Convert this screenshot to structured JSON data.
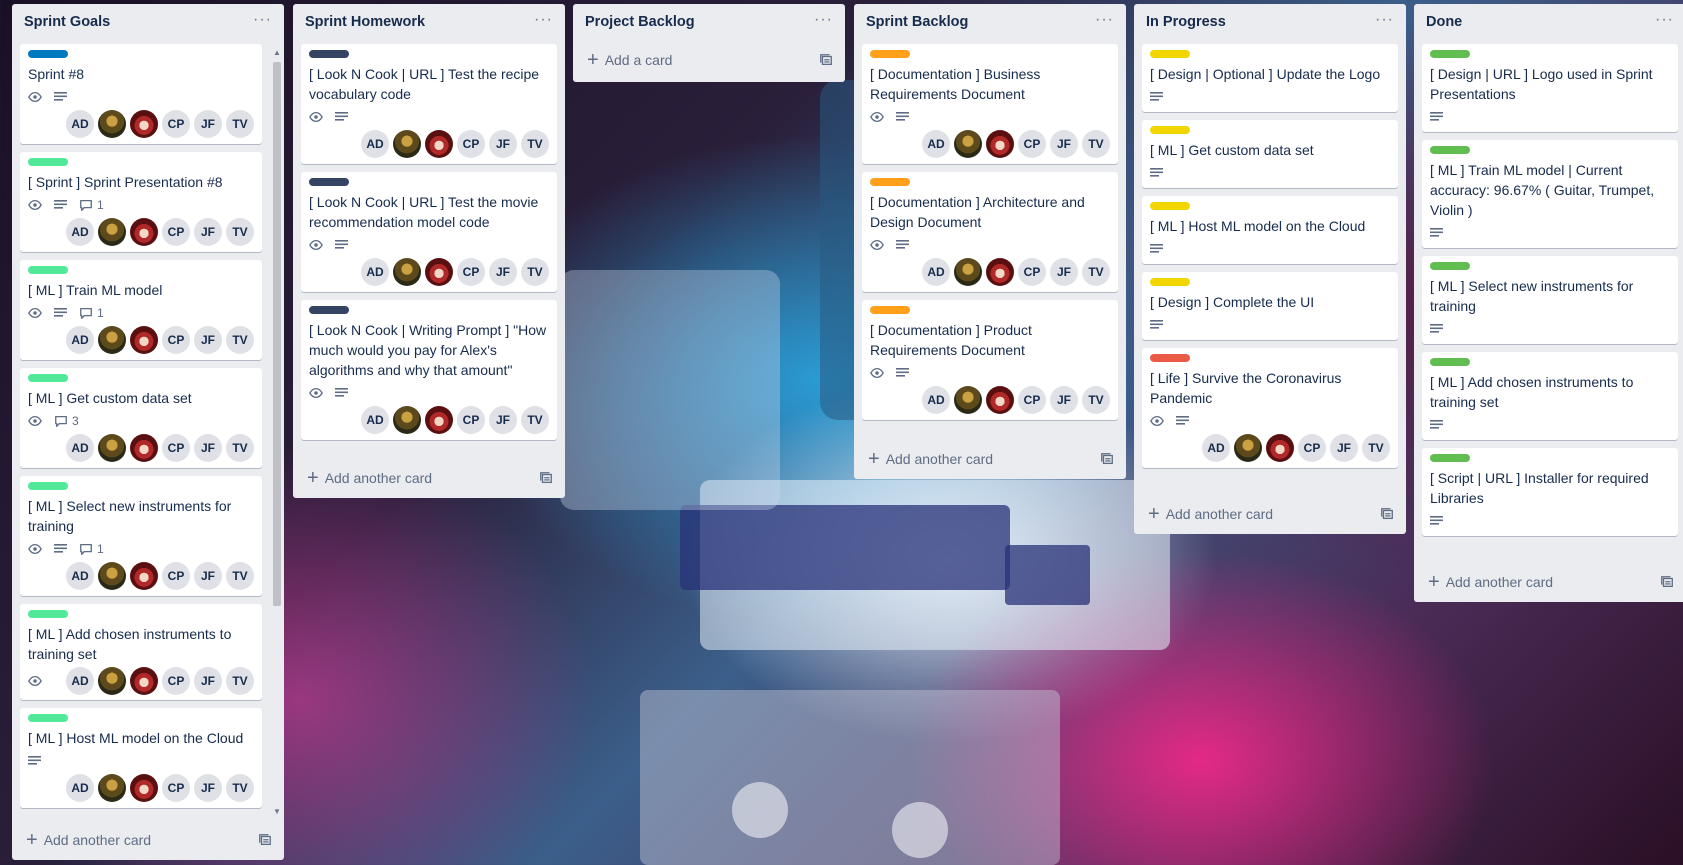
{
  "colors": {
    "blue": "#0079bf",
    "green": "#61bd4f",
    "mint": "#51e898",
    "navy": "#344563",
    "orange": "#ff9f1a",
    "yellow": "#f2d600",
    "red": "#eb5a46"
  },
  "members": [
    "AD",
    "",
    "",
    "CP",
    "JF",
    "TV"
  ],
  "lists": [
    {
      "title": "Sprint Goals",
      "footer": "Add another card",
      "cards": [
        {
          "label": "blue",
          "title": "Sprint #8",
          "watch": true,
          "desc": true,
          "comments": "",
          "members": true
        },
        {
          "label": "mint",
          "title": "[ Sprint ] Sprint Presentation #8",
          "watch": true,
          "desc": true,
          "comments": "1",
          "members": true
        },
        {
          "label": "mint",
          "title": "[ ML ] Train ML model",
          "watch": true,
          "desc": true,
          "comments": "1",
          "members": true
        },
        {
          "label": "mint",
          "title": "[ ML ] Get custom data set",
          "watch": true,
          "desc": false,
          "comments": "3",
          "members": true
        },
        {
          "label": "mint",
          "title": "[ ML ] Select new instruments for training",
          "watch": true,
          "desc": true,
          "comments": "1",
          "members": true
        },
        {
          "label": "mint",
          "title": "[ ML ] Add chosen instruments to training set",
          "watch": true,
          "desc": false,
          "comments": "",
          "members": true,
          "inline": true
        },
        {
          "label": "mint",
          "title": "[ ML ] Host ML model on the Cloud",
          "watch": false,
          "desc": true,
          "comments": "",
          "members": true
        }
      ]
    },
    {
      "title": "Sprint Homework",
      "footer": "Add another card",
      "cards": [
        {
          "label": "navy",
          "title": "[ Look N Cook | URL ] Test the recipe vocabulary code",
          "watch": true,
          "desc": true,
          "comments": "",
          "members": true
        },
        {
          "label": "navy",
          "title": "[ Look N Cook | URL ] Test the movie recommendation model code",
          "watch": true,
          "desc": true,
          "comments": "",
          "members": true
        },
        {
          "label": "navy",
          "title": "[ Look N Cook | Writing Prompt ] \"How much would you pay for Alex's algorithms and why that amount\"",
          "watch": true,
          "desc": true,
          "comments": "",
          "members": true
        }
      ]
    },
    {
      "title": "Project Backlog",
      "footer": "Add a card",
      "cards": []
    },
    {
      "title": "Sprint Backlog",
      "footer": "Add another card",
      "cards": [
        {
          "label": "orange",
          "title": "[ Documentation ] Business Requirements Document",
          "watch": true,
          "desc": true,
          "comments": "",
          "members": true
        },
        {
          "label": "orange",
          "title": "[ Documentation ] Architecture and Design Document",
          "watch": true,
          "desc": true,
          "comments": "",
          "members": true
        },
        {
          "label": "orange",
          "title": "[ Documentation ] Product Requirements Document",
          "watch": true,
          "desc": true,
          "comments": "",
          "members": true
        }
      ]
    },
    {
      "title": "In Progress",
      "footer": "Add another card",
      "cards": [
        {
          "label": "yellow",
          "title": "[ Design | Optional ] Update the Logo",
          "watch": false,
          "desc": true,
          "comments": "",
          "members": false
        },
        {
          "label": "yellow",
          "title": "[ ML ] Get custom data set",
          "watch": false,
          "desc": true,
          "comments": "",
          "members": false
        },
        {
          "label": "yellow",
          "title": "[ ML ] Host ML model on the Cloud",
          "watch": false,
          "desc": true,
          "comments": "",
          "members": false
        },
        {
          "label": "yellow",
          "title": "[ Design ] Complete the UI",
          "watch": false,
          "desc": true,
          "comments": "",
          "members": false
        },
        {
          "label": "red",
          "title": "[ Life ] Survive the Coronavirus Pandemic",
          "watch": true,
          "desc": true,
          "comments": "",
          "members": true
        }
      ]
    },
    {
      "title": "Done",
      "footer": "Add another card",
      "cards": [
        {
          "label": "green",
          "title": "[ Design | URL ] Logo used in Sprint Presentations",
          "watch": false,
          "desc": true,
          "comments": "",
          "members": false
        },
        {
          "label": "green",
          "title": "[ ML ] Train ML model | Current accuracy: 96.67% ( Guitar, Trumpet, Violin )",
          "watch": false,
          "desc": true,
          "comments": "",
          "members": false
        },
        {
          "label": "green",
          "title": "[ ML ] Select new instruments for training",
          "watch": false,
          "desc": true,
          "comments": "",
          "members": false
        },
        {
          "label": "green",
          "title": "[ ML ] Add chosen instruments to training set",
          "watch": false,
          "desc": true,
          "comments": "",
          "members": false
        },
        {
          "label": "green",
          "title": "[ Script | URL ] Installer for required Libraries",
          "watch": false,
          "desc": true,
          "comments": "",
          "members": false
        }
      ]
    }
  ]
}
